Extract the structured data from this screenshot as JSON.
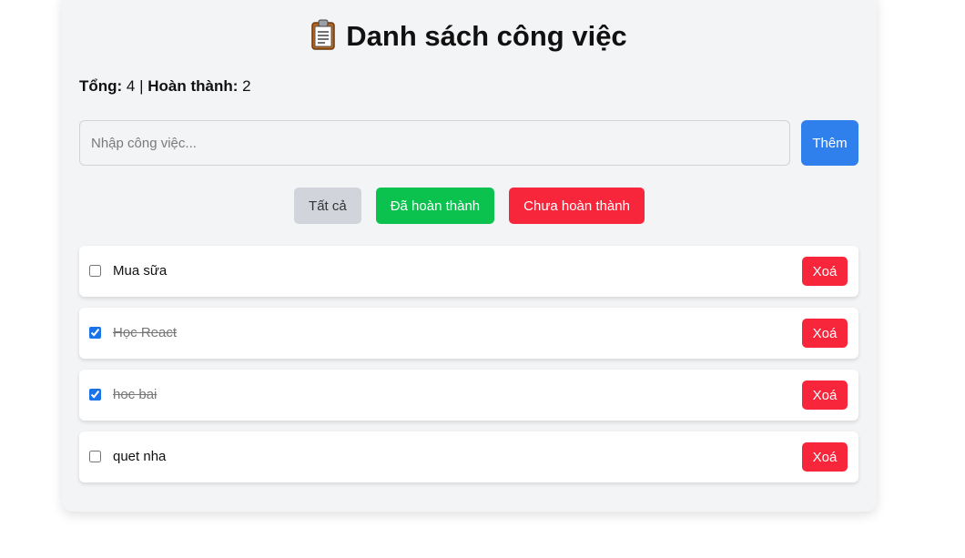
{
  "header": {
    "title": "Danh sách công việc",
    "icon": "clipboard-icon"
  },
  "stats": {
    "total_label": "Tổng:",
    "total_value": " 4 ",
    "separator": "| ",
    "completed_label": "Hoàn thành:",
    "completed_value": " 2"
  },
  "form": {
    "input_placeholder": "Nhập công việc...",
    "input_value": "",
    "add_label": "Thêm"
  },
  "filters": {
    "all_label": "Tất cả",
    "done_label": "Đã hoàn thành",
    "undone_label": "Chưa hoàn thành"
  },
  "tasks": [
    {
      "text": "Mua sữa",
      "completed": false,
      "delete_label": "Xoá"
    },
    {
      "text": "Học React",
      "completed": true,
      "delete_label": "Xoá"
    },
    {
      "text": "hoc bai",
      "completed": true,
      "delete_label": "Xoá"
    },
    {
      "text": "quet nha",
      "completed": false,
      "delete_label": "Xoá"
    }
  ],
  "colors": {
    "primary": "#2f80ed",
    "success": "#0bc24e",
    "danger": "#f7263b",
    "neutral": "#d1d5db",
    "card_bg": "#f3f4f6"
  }
}
